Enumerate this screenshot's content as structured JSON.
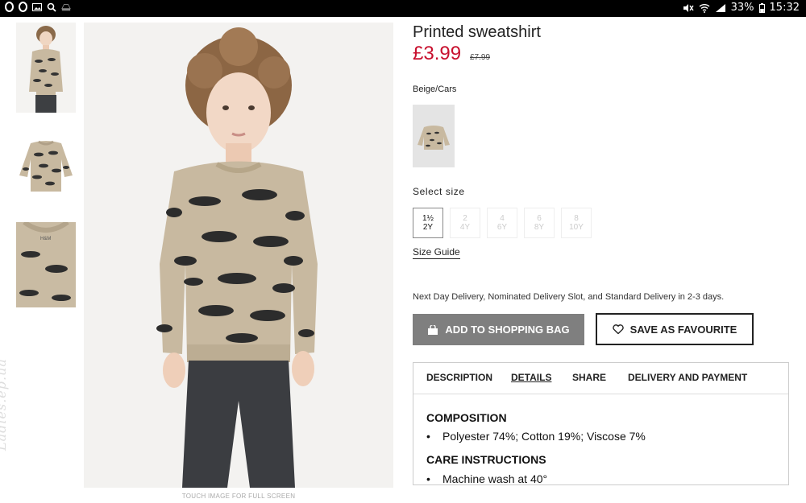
{
  "status_bar": {
    "battery": "33%",
    "time": "15:32"
  },
  "product": {
    "title": "Printed sweatshirt",
    "price": "£3.99",
    "old_price": "£7.99",
    "color_name": "Beige/Cars",
    "select_size_label": "Select size",
    "sizes": [
      {
        "top": "1½",
        "bottom": "2Y",
        "selected": true
      },
      {
        "top": "2",
        "bottom": "4Y",
        "selected": false
      },
      {
        "top": "4",
        "bottom": "6Y",
        "selected": false
      },
      {
        "top": "6",
        "bottom": "8Y",
        "selected": false
      },
      {
        "top": "8",
        "bottom": "10Y",
        "selected": false
      }
    ],
    "size_guide": "Size Guide",
    "delivery_text": "Next Day Delivery, Nominated Delivery Slot, and Standard Delivery in 2-3 days.",
    "add_to_bag": "ADD TO SHOPPING BAG",
    "save_favourite": "SAVE AS FAVOURITE"
  },
  "image_hint": "TOUCH IMAGE FOR FULL SCREEN",
  "watermark": "Ladies.ep.ua",
  "tabs": [
    "DESCRIPTION",
    "DETAILS",
    "SHARE",
    "DELIVERY AND PAYMENT"
  ],
  "active_tab": "DETAILS",
  "details": {
    "composition_heading": "COMPOSITION",
    "composition_item": "Polyester 74%; Cotton 19%; Viscose 7%",
    "care_heading": "CARE INSTRUCTIONS",
    "care_item": "Machine wash at 40°"
  },
  "colors": {
    "price_red": "#c8102e",
    "bag_button": "#7f7f7f",
    "image_bg": "#f3f2f0",
    "sweater": "#c8b9a0"
  }
}
